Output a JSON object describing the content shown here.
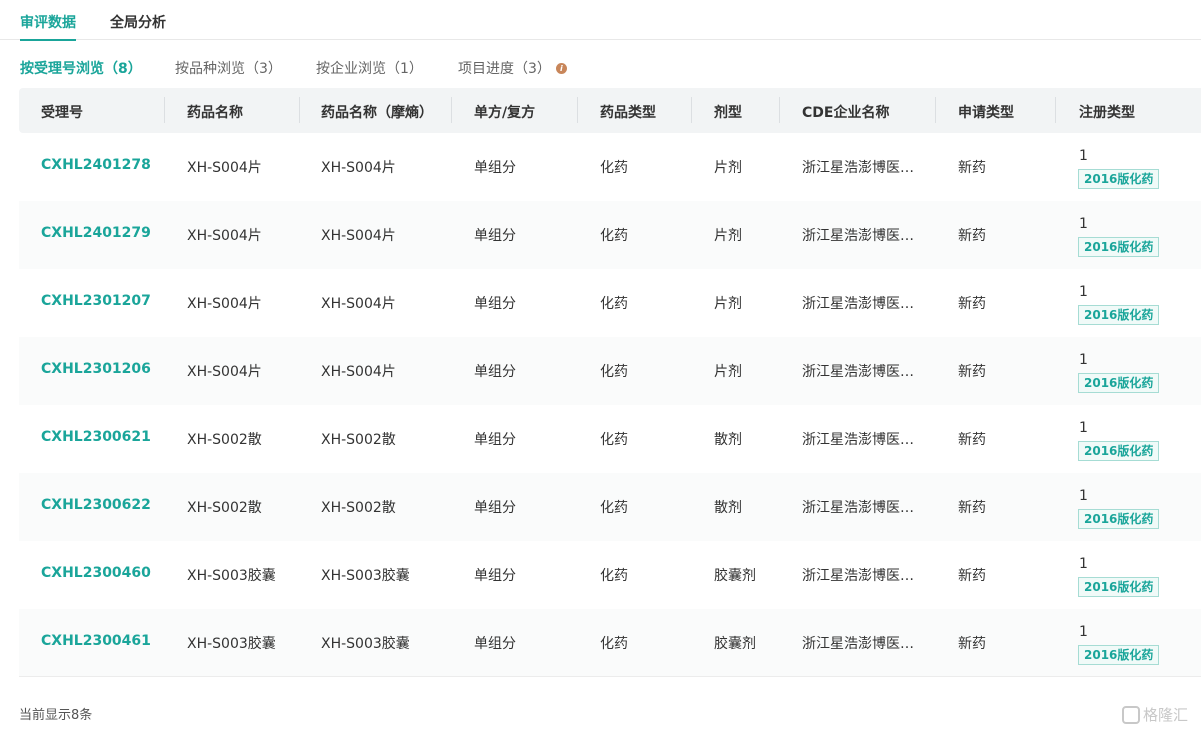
{
  "top_tabs": [
    {
      "label": "审评数据"
    },
    {
      "label": "全局分析"
    }
  ],
  "sub_tabs": [
    {
      "label": "按受理号浏览（8）"
    },
    {
      "label": "按品种浏览（3）"
    },
    {
      "label": "按企业浏览（1）"
    },
    {
      "label": "项目进度（3）"
    }
  ],
  "info_icon_glyph": "i",
  "table": {
    "headers": [
      "受理号",
      "药品名称",
      "药品名称（摩熵）",
      "单方/复方",
      "药品类型",
      "剂型",
      "CDE企业名称",
      "申请类型",
      "注册类型"
    ],
    "rows": [
      {
        "id": "CXHL2401278",
        "name": "XH-S004片",
        "name_moshang": "XH-S004片",
        "composition": "单组分",
        "drug_type": "化药",
        "dosage_form": "片剂",
        "company": "浙江星浩澎博医…",
        "apply_type": "新药",
        "reg_num": "1",
        "reg_tag": "2016版化药"
      },
      {
        "id": "CXHL2401279",
        "name": "XH-S004片",
        "name_moshang": "XH-S004片",
        "composition": "单组分",
        "drug_type": "化药",
        "dosage_form": "片剂",
        "company": "浙江星浩澎博医…",
        "apply_type": "新药",
        "reg_num": "1",
        "reg_tag": "2016版化药"
      },
      {
        "id": "CXHL2301207",
        "name": "XH-S004片",
        "name_moshang": "XH-S004片",
        "composition": "单组分",
        "drug_type": "化药",
        "dosage_form": "片剂",
        "company": "浙江星浩澎博医…",
        "apply_type": "新药",
        "reg_num": "1",
        "reg_tag": "2016版化药"
      },
      {
        "id": "CXHL2301206",
        "name": "XH-S004片",
        "name_moshang": "XH-S004片",
        "composition": "单组分",
        "drug_type": "化药",
        "dosage_form": "片剂",
        "company": "浙江星浩澎博医…",
        "apply_type": "新药",
        "reg_num": "1",
        "reg_tag": "2016版化药"
      },
      {
        "id": "CXHL2300621",
        "name": "XH-S002散",
        "name_moshang": "XH-S002散",
        "composition": "单组分",
        "drug_type": "化药",
        "dosage_form": "散剂",
        "company": "浙江星浩澎博医…",
        "apply_type": "新药",
        "reg_num": "1",
        "reg_tag": "2016版化药"
      },
      {
        "id": "CXHL2300622",
        "name": "XH-S002散",
        "name_moshang": "XH-S002散",
        "composition": "单组分",
        "drug_type": "化药",
        "dosage_form": "散剂",
        "company": "浙江星浩澎博医…",
        "apply_type": "新药",
        "reg_num": "1",
        "reg_tag": "2016版化药"
      },
      {
        "id": "CXHL2300460",
        "name": "XH-S003胶囊",
        "name_moshang": "XH-S003胶囊",
        "composition": "单组分",
        "drug_type": "化药",
        "dosage_form": "胶囊剂",
        "company": "浙江星浩澎博医…",
        "apply_type": "新药",
        "reg_num": "1",
        "reg_tag": "2016版化药"
      },
      {
        "id": "CXHL2300461",
        "name": "XH-S003胶囊",
        "name_moshang": "XH-S003胶囊",
        "composition": "单组分",
        "drug_type": "化药",
        "dosage_form": "胶囊剂",
        "company": "浙江星浩澎博医…",
        "apply_type": "新药",
        "reg_num": "1",
        "reg_tag": "2016版化药"
      }
    ]
  },
  "footer": {
    "count_text": "当前显示8条"
  },
  "watermark": {
    "text": "格隆汇"
  },
  "colors": {
    "accent": "#1aa59a",
    "info_icon": "#c8865a",
    "header_bg": "#f2f4f5"
  }
}
